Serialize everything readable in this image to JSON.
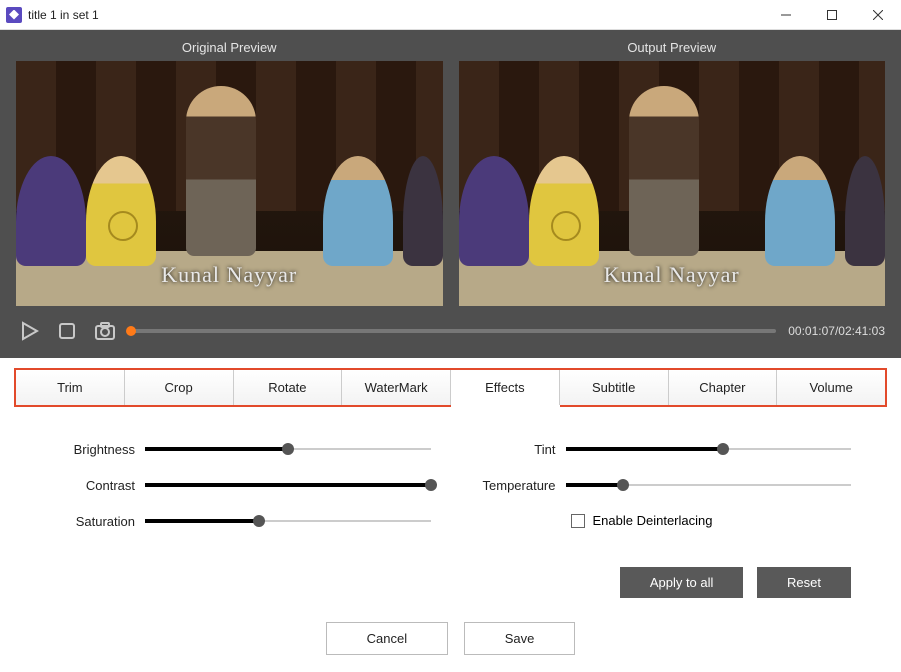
{
  "window": {
    "title": "title 1 in set 1"
  },
  "preview": {
    "original_label": "Original Preview",
    "output_label": "Output Preview",
    "watermark": "Kunal Nayyar",
    "time": "00:01:07/02:41:03"
  },
  "tabs": {
    "trim": "Trim",
    "crop": "Crop",
    "rotate": "Rotate",
    "watermark": "WaterMark",
    "effects": "Effects",
    "subtitle": "Subtitle",
    "chapter": "Chapter",
    "volume": "Volume",
    "active": "effects"
  },
  "effects": {
    "brightness": {
      "label": "Brightness",
      "value": 50
    },
    "contrast": {
      "label": "Contrast",
      "value": 100
    },
    "saturation": {
      "label": "Saturation",
      "value": 40
    },
    "tint": {
      "label": "Tint",
      "value": 55
    },
    "temperature": {
      "label": "Temperature",
      "value": 20
    },
    "deinterlace": {
      "label": "Enable Deinterlacing",
      "checked": false
    }
  },
  "buttons": {
    "apply_all": "Apply to all",
    "reset": "Reset",
    "cancel": "Cancel",
    "save": "Save"
  }
}
